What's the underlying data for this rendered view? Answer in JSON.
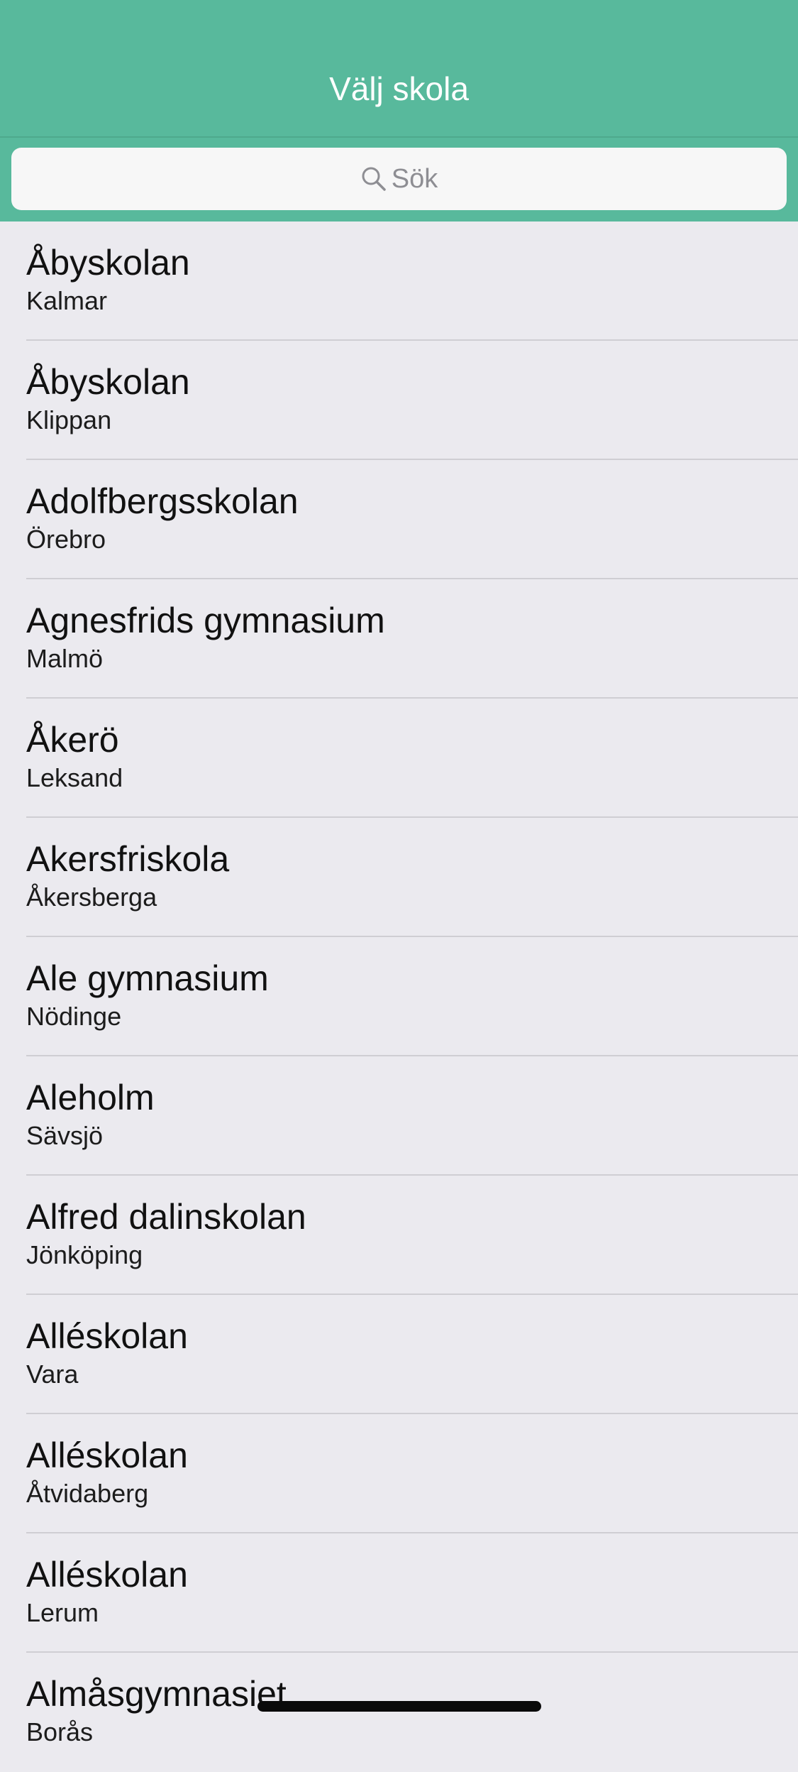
{
  "header": {
    "title": "Välj skola",
    "background_color": "#58b99c"
  },
  "search": {
    "placeholder": "Sök",
    "icon": "search-icon"
  },
  "schools": [
    {
      "name": "Åbyskolan",
      "city": "Kalmar"
    },
    {
      "name": "Åbyskolan",
      "city": "Klippan"
    },
    {
      "name": "Adolfbergsskolan",
      "city": "Örebro"
    },
    {
      "name": "Agnesfrids gymnasium",
      "city": "Malmö"
    },
    {
      "name": "Åkerö",
      "city": "Leksand"
    },
    {
      "name": "Akersfriskola",
      "city": "Åkersberga"
    },
    {
      "name": "Ale gymnasium",
      "city": "Nödinge"
    },
    {
      "name": "Aleholm",
      "city": "Sävsjö"
    },
    {
      "name": "Alfred dalinskolan",
      "city": "Jönköping"
    },
    {
      "name": "Alléskolan",
      "city": "Vara"
    },
    {
      "name": "Alléskolan",
      "city": "Åtvidaberg"
    },
    {
      "name": "Alléskolan",
      "city": "Lerum"
    },
    {
      "name": "Almåsgymnasiet",
      "city": "Borås"
    }
  ]
}
